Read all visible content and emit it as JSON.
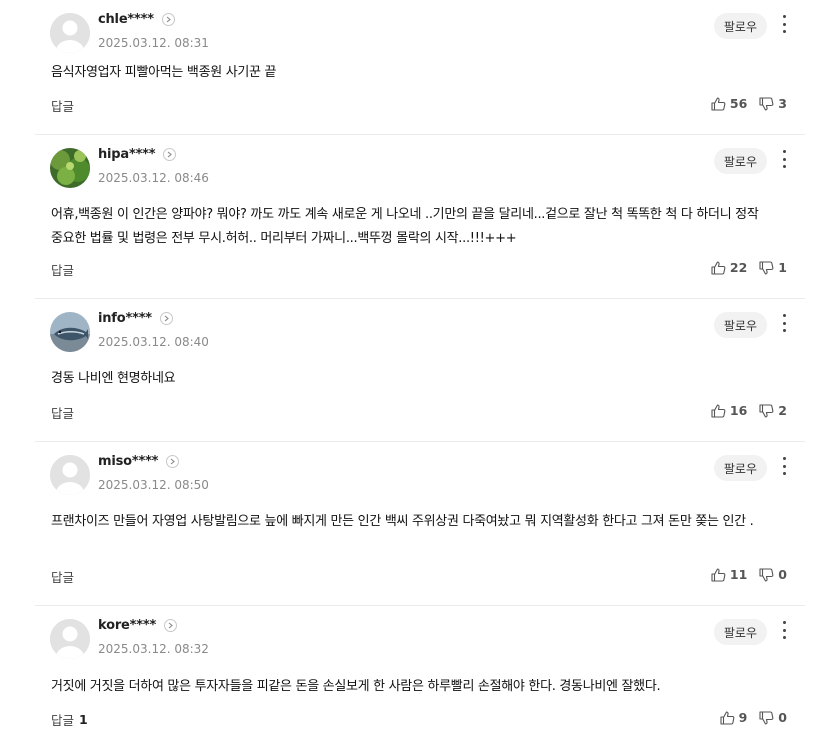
{
  "comments": [
    {
      "username": "chle****",
      "timestamp": "2025.03.12. 08:31",
      "text": "음식자영업자 피빨아먹는 백종원 사기꾼 끝",
      "reply_label": "답글",
      "reply_count": "",
      "likes": "56",
      "dislikes": "3",
      "follow_label": "팔로우",
      "avatar": "default-avatar"
    },
    {
      "username": "hipa****",
      "timestamp": "2025.03.12. 08:46",
      "text": "어휴,백종원 이 인간은 양파야? 뭐야? 까도 까도 계속 새로운 게 나오네 ..기만의 끝을 달리네...겉으로 잘난 척 똑똑한 척 다 하더니 정작 중요한 법률 및 법령은 전부 무시.허허.. 머리부터 가짜니...백뚜껑 몰락의 시작...!!!+++",
      "reply_label": "답글",
      "reply_count": "",
      "likes": "22",
      "dislikes": "1",
      "follow_label": "팔로우",
      "avatar": "plant-photo-avatar"
    },
    {
      "username": "info****",
      "timestamp": "2025.03.12. 08:40",
      "text": "경동 나비엔 현명하네요",
      "reply_label": "답글",
      "reply_count": "",
      "likes": "16",
      "dislikes": "2",
      "follow_label": "팔로우",
      "avatar": "fish-photo-avatar"
    },
    {
      "username": "miso****",
      "timestamp": "2025.03.12. 08:50",
      "text": "프랜차이즈 만들어 자영업 사탕발림으로 늪에 빠지게 만든 인간 백씨 주위상권 다죽여놨고 뭐 지역활성화 한다고 그져 돈만 쫒는 인간 .",
      "reply_label": "답글",
      "reply_count": "",
      "likes": "11",
      "dislikes": "0",
      "follow_label": "팔로우",
      "avatar": "default-avatar"
    },
    {
      "username": "kore****",
      "timestamp": "2025.03.12. 08:32",
      "text": "거짓에 거짓을 더하여 많은 투자자들을 피같은 돈을 손실보게 한 사람은 하루빨리 손절해야 한다. 경동나비엔 잘했다.",
      "reply_label": "답글",
      "reply_count": "1",
      "likes": "9",
      "dislikes": "0",
      "follow_label": "팔로우",
      "avatar": "default-avatar"
    }
  ],
  "icons": {
    "like": "thumbs-up-icon",
    "dislike": "thumbs-down-icon",
    "more": "kebab-menu-icon",
    "profile": "chevron-right-icon"
  }
}
